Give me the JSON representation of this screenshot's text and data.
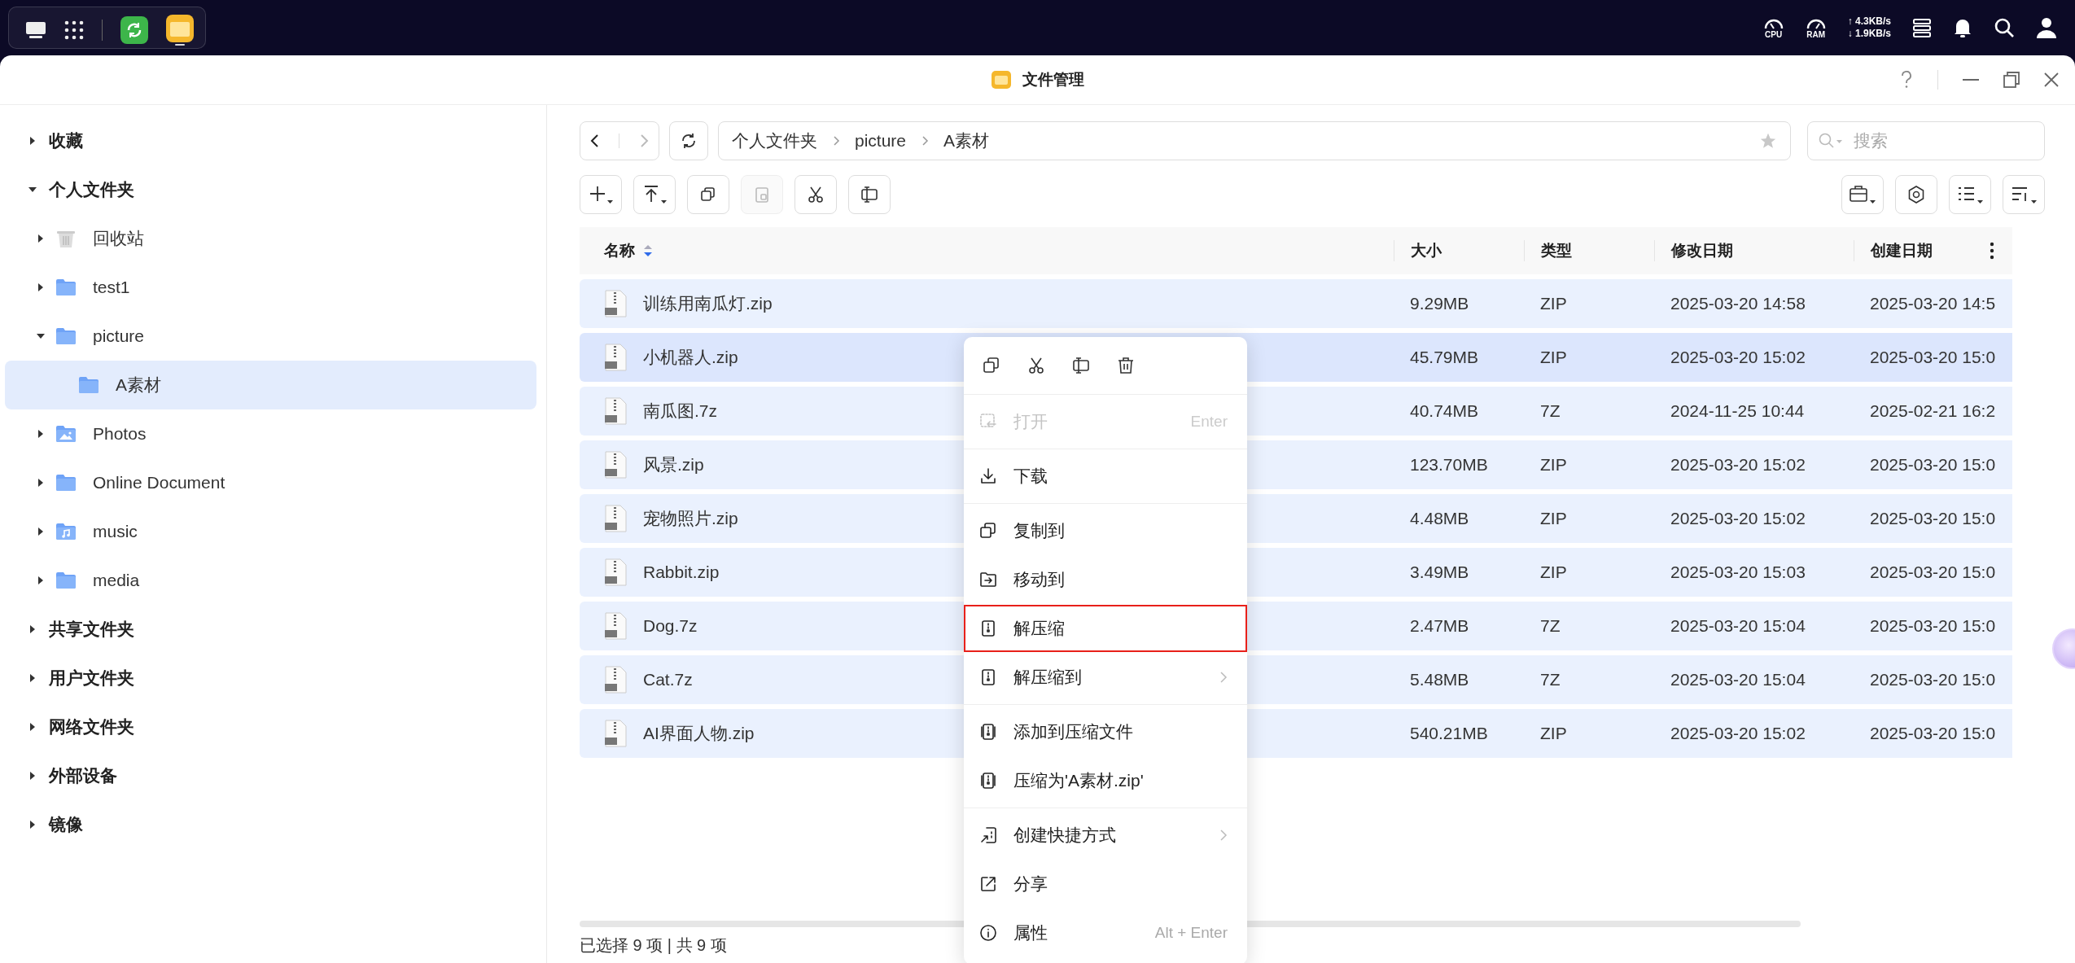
{
  "system_tray": {
    "cpu_label": "CPU",
    "ram_label": "RAM",
    "upload": "↑ 4.3KB/s",
    "download": "↓ 1.9KB/s"
  },
  "window": {
    "title": "文件管理"
  },
  "sidebar": [
    {
      "label": "收藏",
      "expanded": false,
      "selected": false
    },
    {
      "label": "个人文件夹",
      "expanded": true,
      "selected": false,
      "children": [
        {
          "label": "回收站",
          "kind": "trash",
          "expanded": false,
          "selected": false
        },
        {
          "label": "test1",
          "kind": "folder",
          "expanded": false,
          "selected": false
        },
        {
          "label": "picture",
          "kind": "folder",
          "expanded": true,
          "selected": false,
          "children": [
            {
              "label": "A素材",
              "kind": "folder",
              "selected": true
            }
          ]
        },
        {
          "label": "Photos",
          "kind": "photos",
          "expanded": false,
          "selected": false
        },
        {
          "label": "Online Document",
          "kind": "folder",
          "expanded": false,
          "selected": false
        },
        {
          "label": "music",
          "kind": "music",
          "expanded": false,
          "selected": false
        },
        {
          "label": "media",
          "kind": "folder",
          "expanded": false,
          "selected": false
        }
      ]
    },
    {
      "label": "共享文件夹",
      "expanded": false,
      "selected": false
    },
    {
      "label": "用户文件夹",
      "expanded": false,
      "selected": false
    },
    {
      "label": "网络文件夹",
      "expanded": false,
      "selected": false
    },
    {
      "label": "外部设备",
      "expanded": false,
      "selected": false
    },
    {
      "label": "镜像",
      "expanded": false,
      "selected": false
    }
  ],
  "path_bar": {
    "crumbs": [
      "个人文件夹",
      "picture",
      "A素材"
    ]
  },
  "search": {
    "placeholder": "搜索"
  },
  "table": {
    "columns": [
      {
        "label": "名称",
        "sorted": true
      },
      {
        "label": "大小"
      },
      {
        "label": "类型"
      },
      {
        "label": "修改日期"
      },
      {
        "label": "创建日期"
      }
    ],
    "rows": [
      {
        "name": "训练用南瓜灯.zip",
        "size": "9.29MB",
        "type": "ZIP",
        "modified": "2025-03-20 14:58",
        "created": "2025-03-20 14:5",
        "selected": true,
        "hovered": false
      },
      {
        "name": "小机器人.zip",
        "size": "45.79MB",
        "type": "ZIP",
        "modified": "2025-03-20 15:02",
        "created": "2025-03-20 15:0",
        "selected": true,
        "hovered": true
      },
      {
        "name": "南瓜图.7z",
        "size": "40.74MB",
        "type": "7Z",
        "modified": "2024-11-25 10:44",
        "created": "2025-02-21 16:2",
        "selected": true,
        "hovered": false
      },
      {
        "name": "风景.zip",
        "size": "123.70MB",
        "type": "ZIP",
        "modified": "2025-03-20 15:02",
        "created": "2025-03-20 15:0",
        "selected": true,
        "hovered": false
      },
      {
        "name": "宠物照片.zip",
        "size": "4.48MB",
        "type": "ZIP",
        "modified": "2025-03-20 15:02",
        "created": "2025-03-20 15:0",
        "selected": true,
        "hovered": false
      },
      {
        "name": "Rabbit.zip",
        "size": "3.49MB",
        "type": "ZIP",
        "modified": "2025-03-20 15:03",
        "created": "2025-03-20 15:0",
        "selected": true,
        "hovered": false
      },
      {
        "name": "Dog.7z",
        "size": "2.47MB",
        "type": "7Z",
        "modified": "2025-03-20 15:04",
        "created": "2025-03-20 15:0",
        "selected": true,
        "hovered": false
      },
      {
        "name": "Cat.7z",
        "size": "5.48MB",
        "type": "7Z",
        "modified": "2025-03-20 15:04",
        "created": "2025-03-20 15:0",
        "selected": true,
        "hovered": false
      },
      {
        "name": "AI界面人物.zip",
        "size": "540.21MB",
        "type": "ZIP",
        "modified": "2025-03-20 15:02",
        "created": "2025-03-20 15:0",
        "selected": true,
        "hovered": false
      }
    ]
  },
  "context_menu": {
    "groups": [
      [
        {
          "label": "打开",
          "shortcut": "Enter",
          "disabled": true,
          "highlighted": false,
          "submenu": false
        }
      ],
      [
        {
          "label": "下载",
          "disabled": false,
          "highlighted": false,
          "submenu": false
        }
      ],
      [
        {
          "label": "复制到",
          "disabled": false,
          "highlighted": false,
          "submenu": false
        },
        {
          "label": "移动到",
          "disabled": false,
          "highlighted": false,
          "submenu": false
        },
        {
          "label": "解压缩",
          "disabled": false,
          "highlighted": true,
          "submenu": false
        },
        {
          "label": "解压缩到",
          "disabled": false,
          "highlighted": false,
          "submenu": true
        }
      ],
      [
        {
          "label": "添加到压缩文件",
          "disabled": false,
          "highlighted": false,
          "submenu": false
        },
        {
          "label": "压缩为'A素材.zip'",
          "disabled": false,
          "highlighted": false,
          "submenu": false
        }
      ],
      [
        {
          "label": "创建快捷方式",
          "disabled": false,
          "highlighted": false,
          "submenu": true
        },
        {
          "label": "分享",
          "disabled": false,
          "highlighted": false,
          "submenu": false
        },
        {
          "label": "属性",
          "shortcut": "Alt + Enter",
          "disabled": false,
          "highlighted": false,
          "submenu": false
        }
      ]
    ]
  },
  "status_bar": {
    "text": "已选择 9 项 | 共 9 项"
  }
}
